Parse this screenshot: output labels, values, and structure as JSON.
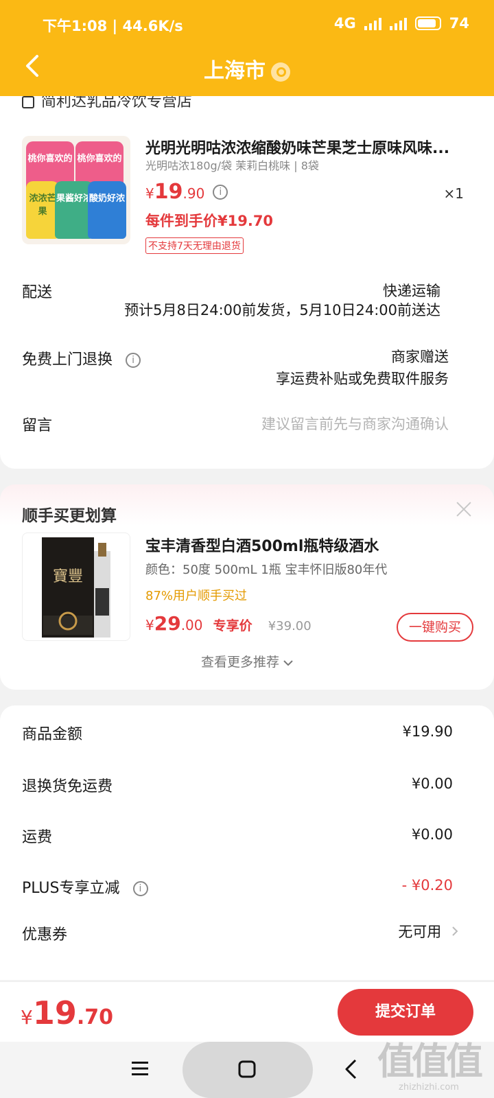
{
  "status_bar": {
    "time": "下午1:08 | 44.6K/s",
    "network": "4G",
    "battery": "74"
  },
  "header": {
    "title": "上海市"
  },
  "shop": {
    "name": "简利达乳品冷饮专营店"
  },
  "product": {
    "name": "光明光明咕浓浓缩酸奶味芒果芝士原味风味...",
    "spec": "光明咕浓180g/袋 茉莉白桃味 | 8袋",
    "price_currency": "¥",
    "price_int": "19",
    "price_dec": ".90",
    "qty": "×1",
    "hand_price": "每件到手价¥19.70",
    "no_return": "不支持7天无理由退货",
    "bag_texts": [
      "桃你喜欢的",
      "桃你喜欢的",
      "浓浓芒果",
      "果酱好浓",
      "酸奶好浓"
    ]
  },
  "delivery": {
    "label": "配送",
    "method": "快递运输",
    "eta": "预计5月8日24:00前发货，5月10日24:00前送达"
  },
  "free_exchange": {
    "label": "免费上门退换",
    "value": "商家赠送",
    "sub": "享运费补贴或免费取件服务"
  },
  "message": {
    "label": "留言",
    "placeholder": "建议留言前先与商家沟通确认"
  },
  "recommend": {
    "title": "顺手买更划算",
    "item_name": "宝丰清香型白酒500ml瓶特级酒水",
    "item_spec": "颜色：50度 500mL 1瓶 宝丰怀旧版80年代",
    "bought": "87%用户顺手买过",
    "price_currency": "¥",
    "price_int": "29",
    "price_dec": ".00",
    "price_tag": "专享价",
    "orig_price": "¥39.00",
    "buy_label": "一键购买",
    "more_label": "查看更多推荐",
    "bottle_label": "寶豐"
  },
  "summary": {
    "rows": [
      {
        "label": "商品金额",
        "value": "¥19.90"
      },
      {
        "label": "退换货免运费",
        "value": "¥0.00"
      },
      {
        "label": "运费",
        "value": "¥0.00"
      },
      {
        "label": "PLUS专享立减",
        "value": "- ¥0.20"
      },
      {
        "label": "优惠券",
        "value": "无可用"
      }
    ]
  },
  "footer": {
    "total_currency": "¥",
    "total_int": "19",
    "total_dec": ".70",
    "submit_label": "提交订单"
  },
  "watermark": {
    "big": "值值值",
    "small": "zhizhizhi.com"
  },
  "colors": {
    "header": "#fbb914",
    "accent": "#e4393c",
    "orange": "#e49a00"
  }
}
